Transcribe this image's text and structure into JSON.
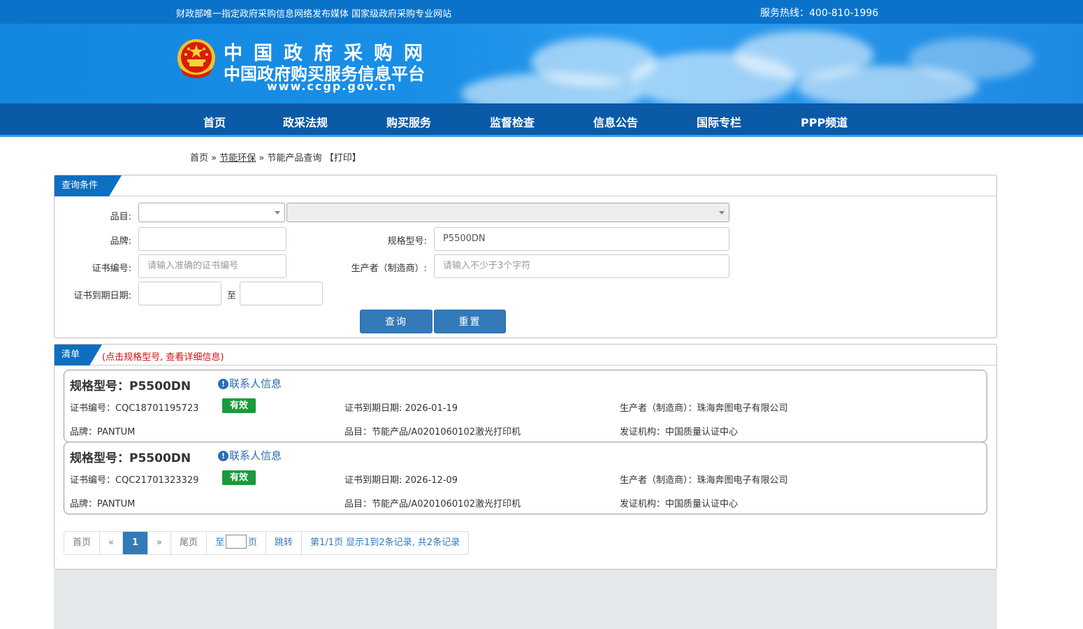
{
  "topbar": {
    "slogan": "财政部唯一指定政府采购信息网络发布媒体 国家级政府采购专业网站",
    "hotline": "服务热线：400-810-1996"
  },
  "logo": {
    "title_line1": "中国政府采购网",
    "title_line2": "中国政府购买服务信息平台",
    "url": "www.ccgp.gov.cn"
  },
  "nav": [
    {
      "label": "首页"
    },
    {
      "label": "政采法规"
    },
    {
      "label": "购买服务"
    },
    {
      "label": "监督检查"
    },
    {
      "label": "信息公告"
    },
    {
      "label": "国际专栏"
    },
    {
      "label": "PPP频道"
    }
  ],
  "breadcrumb": {
    "home": "首页",
    "sep": "»",
    "section": "节能环保",
    "page": "节能产品查询",
    "print": "【打印】"
  },
  "query": {
    "tab": "查询条件",
    "category_label": "品目:",
    "brand_label": "品牌:",
    "model_label": "规格型号:",
    "model_value": "P5500DN",
    "cert_label": "证书编号:",
    "cert_placeholder": "请输入准确的证书编号",
    "maker_label": "生产者（制造商）:",
    "maker_placeholder": "请输入不少于3个字符",
    "expire_label": "证书到期日期:",
    "to_label": "至",
    "search_btn": "查询",
    "reset_btn": "重置"
  },
  "list": {
    "tab": "清单",
    "hint": "(点击规格型号, 查看详细信息)",
    "items": [
      {
        "model": "规格型号：P5500DN",
        "contact": "联系人信息",
        "cert": "证书编号：CQC18701195723",
        "status": "有效",
        "expire": "证书到期日期: 2026-01-19",
        "maker": "生产者（制造商）：珠海奔图电子有限公司",
        "brand": "品牌：PANTUM",
        "category": "品目：节能产品/A0201060102激光打印机",
        "issuer": "发证机构：中国质量认证中心"
      },
      {
        "model": "规格型号：P5500DN",
        "contact": "联系人信息",
        "cert": "证书编号：CQC21701323329",
        "status": "有效",
        "expire": "证书到期日期: 2026-12-09",
        "maker": "生产者（制造商）：珠海奔图电子有限公司",
        "brand": "品牌：PANTUM",
        "category": "品目：节能产品/A0201060102激光打印机",
        "issuer": "发证机构：中国质量认证中心"
      }
    ]
  },
  "pager": {
    "first": "首页",
    "prev": "«",
    "current": "1",
    "next": "»",
    "last": "尾页",
    "goto_prefix": "至",
    "goto_suffix": "页",
    "jump": "跳转",
    "summary": "第1/1页  显示1到2条记录, 共2条记录"
  },
  "colors": {
    "brand_blue": "#0a73c9",
    "nav_blue": "#0a5aa8",
    "valid_green": "#1a9a3a",
    "hint_red": "#d01010"
  }
}
